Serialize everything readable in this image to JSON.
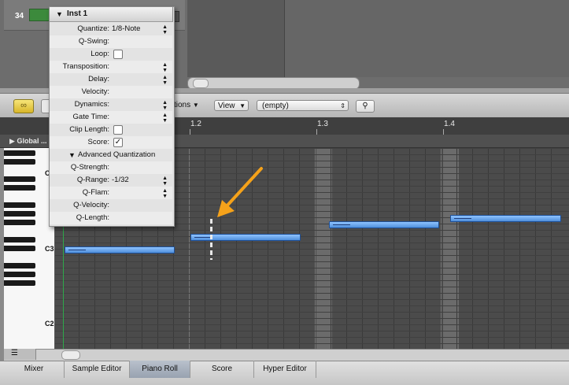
{
  "arrange": {
    "track_number": "34"
  },
  "toolbar": {
    "functions_label": "ctions",
    "view_label": "View",
    "region_select_value": "(empty)"
  },
  "ruler": {
    "labels": [
      "1.2",
      "1.3",
      "1.4"
    ],
    "global_label": "Global ..."
  },
  "keyboard": {
    "octave_labels": [
      "C",
      "C3",
      "C2"
    ]
  },
  "inspector": {
    "title": "Inst 1",
    "rows": [
      {
        "label": "Quantize:",
        "value": "1/8-Note"
      },
      {
        "label": "Q-Swing:",
        "value": ""
      },
      {
        "label": "Loop:",
        "value": ""
      },
      {
        "label": "Transposition:",
        "value": ""
      },
      {
        "label": "Delay:",
        "value": ""
      },
      {
        "label": "Velocity:",
        "value": ""
      },
      {
        "label": "Dynamics:",
        "value": ""
      },
      {
        "label": "Gate Time:",
        "value": ""
      },
      {
        "label": "Clip Length:",
        "value": ""
      },
      {
        "label": "Score:",
        "value": ""
      }
    ],
    "loop_checked": false,
    "clip_length_checked": false,
    "score_checked": true,
    "advanced_title": "Advanced Quantization",
    "advanced_rows": [
      {
        "label": "Q-Strength:",
        "value": ""
      },
      {
        "label": "Q-Range:",
        "value": "-1/32"
      },
      {
        "label": "Q-Flam:",
        "value": ""
      },
      {
        "label": "Q-Velocity:",
        "value": ""
      },
      {
        "label": "Q-Length:",
        "value": ""
      }
    ]
  },
  "tabs": [
    {
      "label": "Mixer",
      "active": false
    },
    {
      "label": "Sample Editor",
      "active": false
    },
    {
      "label": "Piano Roll",
      "active": true
    },
    {
      "label": "Score",
      "active": false
    },
    {
      "label": "Hyper Editor",
      "active": false
    }
  ],
  "colors": {
    "note": "#6aa8f0",
    "playhead": "#2ea84a",
    "arrow": "#f5a21a",
    "link_button": "#e8cc4a"
  },
  "icons": {
    "link": "link-icon",
    "search": "magnifier-icon",
    "zoom": "zoom-slider-icon"
  }
}
